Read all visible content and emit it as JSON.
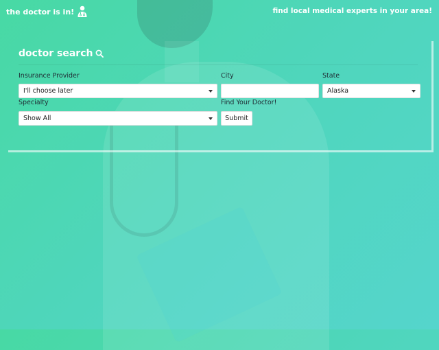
{
  "header": {
    "brand": "the doctor is in!",
    "tagline": "find local medical experts in your area!"
  },
  "search": {
    "title": "doctor search",
    "insurance": {
      "label": "Insurance Provider",
      "value": "I'll choose later"
    },
    "city": {
      "label": "City",
      "value": ""
    },
    "state": {
      "label": "State",
      "value": "Alaska"
    },
    "specialty": {
      "label": "Specialty",
      "value": "Show All"
    },
    "find": {
      "label": "Find Your Doctor!",
      "button": "Submit"
    }
  },
  "icons": {
    "brand": "doctor-icon",
    "search": "search-icon"
  },
  "colors": {
    "background_start": "#48d9a4",
    "background_end": "#55d5cc",
    "text_light": "#ffffff"
  }
}
